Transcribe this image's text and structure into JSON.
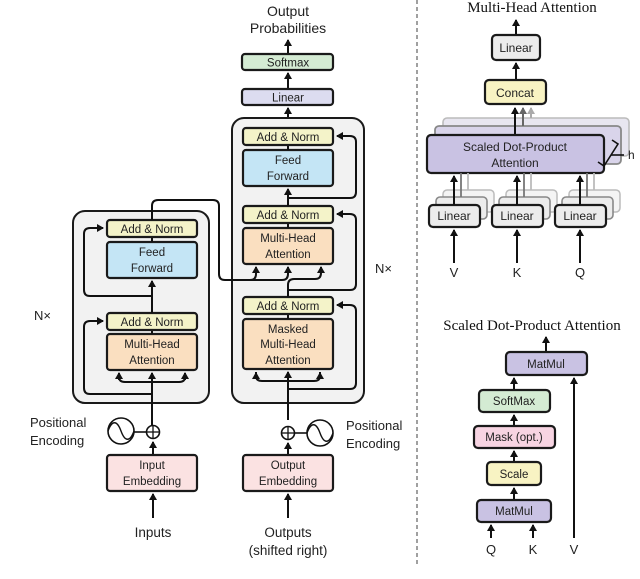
{
  "colors": {
    "add_norm": "#f4f3c9",
    "feed_forward": "#c4e5f5",
    "attention": "#fadfc0",
    "embedding": "#fbe2e2",
    "linear": "#dcdcf0",
    "softmax": "#d4ebd3",
    "sdpa": "#c9c2e3",
    "concat": "#f8f3c3",
    "mha_linear": "#ececec",
    "mask": "#f7d4e2",
    "scale": "#f8f3c3",
    "matmul": "#c9c2e3",
    "block_bg": "#f2f2f2"
  },
  "transformer": {
    "output_label_line1": "Output",
    "output_label_line2": "Probabilities",
    "softmax": "Softmax",
    "linear": "Linear",
    "nx_label": "N×",
    "decoder": {
      "add_norm_3": "Add & Norm",
      "feed_forward_line1": "Feed",
      "feed_forward_line2": "Forward",
      "add_norm_2": "Add & Norm",
      "mha_line1": "Multi-Head",
      "mha_line2": "Attention",
      "add_norm_1": "Add & Norm",
      "masked_line1": "Masked",
      "masked_line2": "Multi-Head",
      "masked_line3": "Attention",
      "nx_label": "N×"
    },
    "encoder": {
      "add_norm_2": "Add & Norm",
      "feed_forward_line1": "Feed",
      "feed_forward_line2": "Forward",
      "add_norm_1": "Add & Norm",
      "mha_line1": "Multi-Head",
      "mha_line2": "Attention",
      "nx_label": "N×"
    },
    "pos_enc_left_line1": "Positional",
    "pos_enc_left_line2": "Encoding",
    "pos_enc_right_line1": "Positional",
    "pos_enc_right_line2": "Encoding",
    "input_embedding_line1": "Input",
    "input_embedding_line2": "Embedding",
    "output_embedding_line1": "Output",
    "output_embedding_line2": "Embedding",
    "inputs_label": "Inputs",
    "outputs_label_line1": "Outputs",
    "outputs_label_line2": "(shifted right)"
  },
  "multi_head": {
    "title": "Multi-Head Attention",
    "linear": "Linear",
    "concat": "Concat",
    "sdpa_line1": "Scaled Dot-Product",
    "sdpa_line2": "Attention",
    "h_label": "h",
    "linear_v": "Linear",
    "linear_k": "Linear",
    "linear_q": "Linear",
    "input_v": "V",
    "input_k": "K",
    "input_q": "Q"
  },
  "sdpa": {
    "title": "Scaled Dot-Product Attention",
    "matmul_top": "MatMul",
    "softmax": "SoftMax",
    "mask": "Mask (opt.)",
    "scale": "Scale",
    "matmul_bottom": "MatMul",
    "input_q": "Q",
    "input_k": "K",
    "input_v": "V"
  }
}
